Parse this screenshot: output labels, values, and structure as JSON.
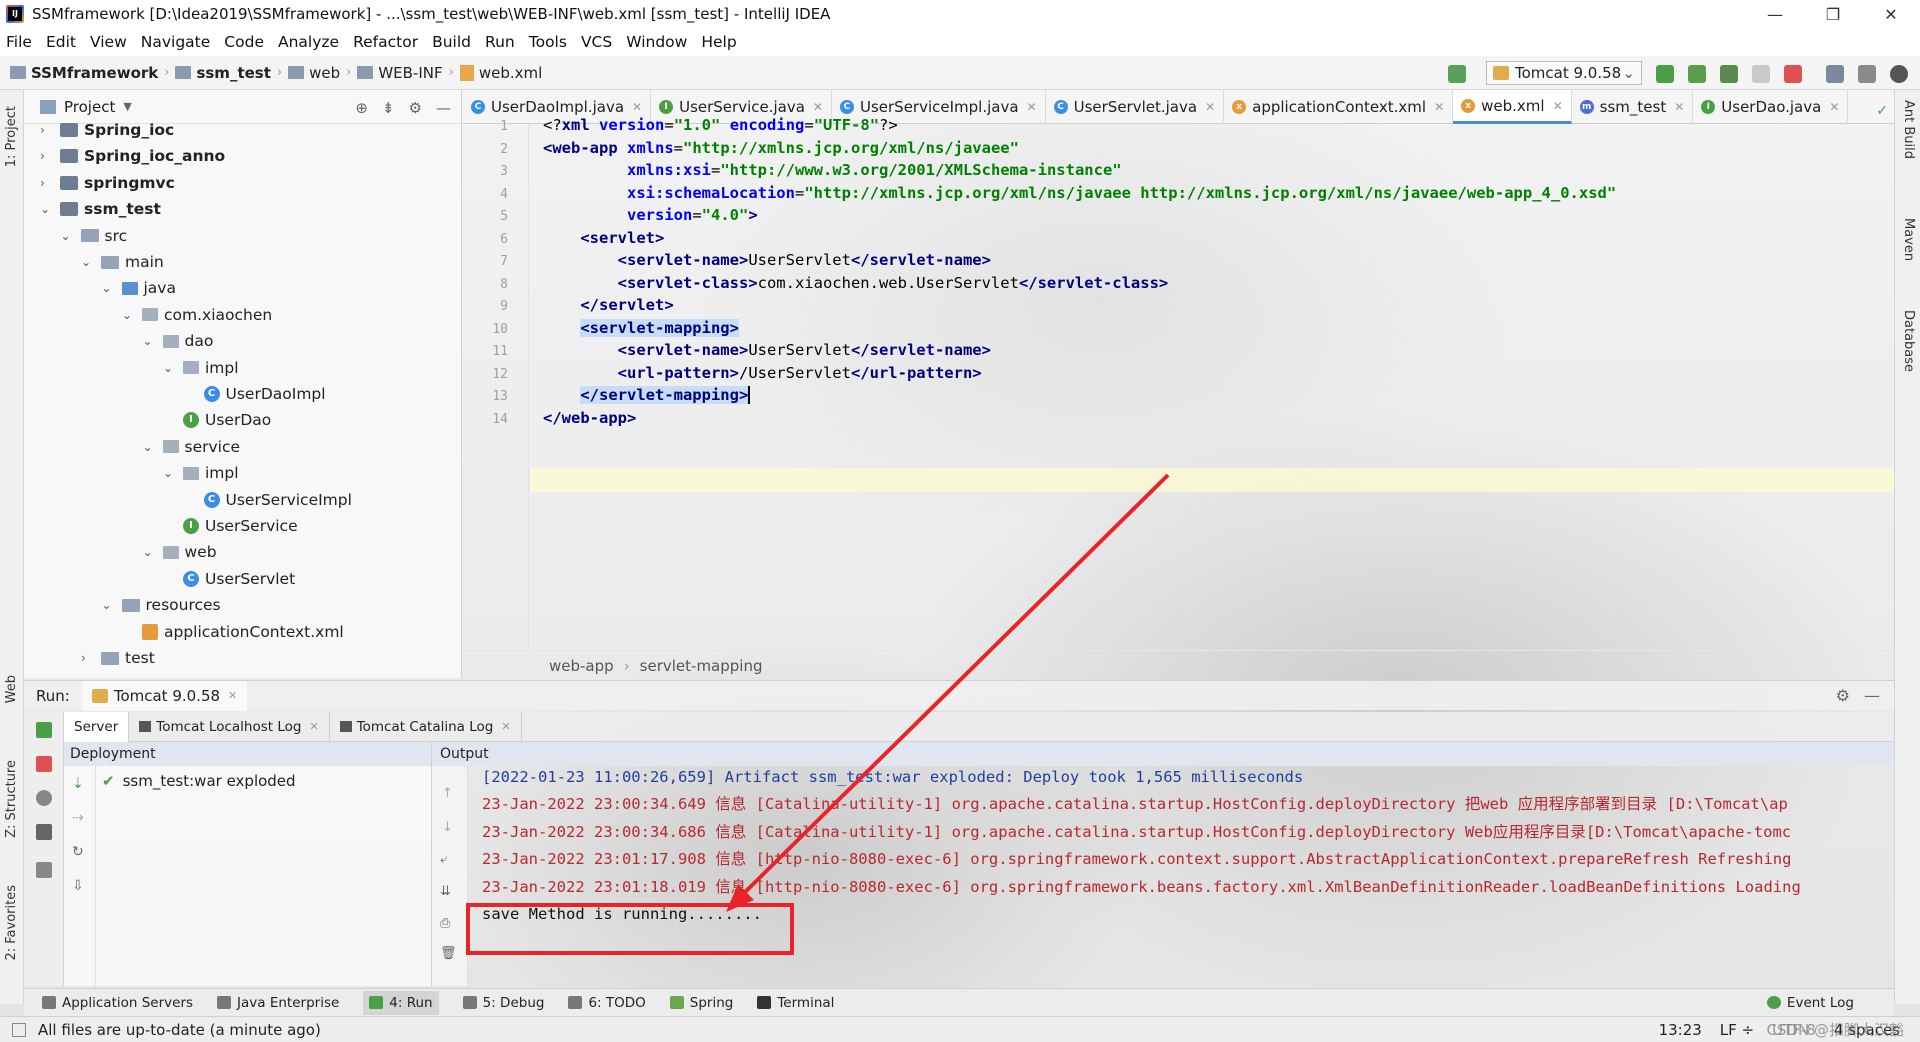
{
  "window": {
    "title": "SSMframework [D:\\Idea2019\\SSMframework] - ...\\ssm_test\\web\\WEB-INF\\web.xml [ssm_test] - IntelliJ IDEA",
    "minimize": "—",
    "maximize": "❐",
    "close": "✕"
  },
  "menu": [
    "File",
    "Edit",
    "View",
    "Navigate",
    "Code",
    "Analyze",
    "Refactor",
    "Build",
    "Run",
    "Tools",
    "VCS",
    "Window",
    "Help"
  ],
  "breadcrumbs": [
    "SSMframework",
    "ssm_test",
    "web",
    "WEB-INF",
    "web.xml"
  ],
  "run_config": "Tomcat 9.0.58",
  "project_panel": {
    "title": "Project",
    "tree": [
      {
        "label": "Spring_ioc",
        "icon": "module-icon",
        "depth": 1,
        "arrow": "›",
        "bold": true
      },
      {
        "label": "Spring_ioc_anno",
        "icon": "module-icon",
        "depth": 1,
        "arrow": "›",
        "bold": true
      },
      {
        "label": "springmvc",
        "icon": "module-icon",
        "depth": 1,
        "arrow": "›",
        "bold": true
      },
      {
        "label": "ssm_test",
        "icon": "module-icon",
        "depth": 1,
        "arrow": "⌄",
        "bold": true
      },
      {
        "label": "src",
        "icon": "folder-icon",
        "depth": 2,
        "arrow": "⌄"
      },
      {
        "label": "main",
        "icon": "folder-icon",
        "depth": 3,
        "arrow": "⌄"
      },
      {
        "label": "java",
        "icon": "java-folder-icon",
        "depth": 4,
        "arrow": "⌄"
      },
      {
        "label": "com.xiaochen",
        "icon": "package-icon",
        "depth": 5,
        "arrow": "⌄"
      },
      {
        "label": "dao",
        "icon": "package-icon",
        "depth": 6,
        "arrow": "⌄"
      },
      {
        "label": "impl",
        "icon": "package-icon",
        "depth": 7,
        "arrow": "⌄"
      },
      {
        "label": "UserDaoImpl",
        "icon": "class-icon",
        "depth": 8,
        "arrow": ""
      },
      {
        "label": "UserDao",
        "icon": "interface-icon",
        "depth": 7,
        "arrow": ""
      },
      {
        "label": "service",
        "icon": "package-icon",
        "depth": 6,
        "arrow": "⌄"
      },
      {
        "label": "impl",
        "icon": "package-icon",
        "depth": 7,
        "arrow": "⌄"
      },
      {
        "label": "UserServiceImpl",
        "icon": "class-icon",
        "depth": 8,
        "arrow": ""
      },
      {
        "label": "UserService",
        "icon": "interface-icon",
        "depth": 7,
        "arrow": ""
      },
      {
        "label": "web",
        "icon": "package-icon",
        "depth": 6,
        "arrow": "⌄"
      },
      {
        "label": "UserServlet",
        "icon": "class-icon",
        "depth": 7,
        "arrow": ""
      },
      {
        "label": "resources",
        "icon": "folder-icon",
        "depth": 4,
        "arrow": "⌄"
      },
      {
        "label": "applicationContext.xml",
        "icon": "xml-icon",
        "depth": 5,
        "arrow": ""
      },
      {
        "label": "test",
        "icon": "folder-icon",
        "depth": 3,
        "arrow": "›"
      }
    ]
  },
  "editor_tabs": [
    {
      "label": "UserDaoImpl.java",
      "icon": "C",
      "color": "#3a8ee6"
    },
    {
      "label": "UserService.java",
      "icon": "I",
      "color": "#4ba047"
    },
    {
      "label": "UserServiceImpl.java",
      "icon": "C",
      "color": "#3a8ee6"
    },
    {
      "label": "UserServlet.java",
      "icon": "C",
      "color": "#3a8ee6"
    },
    {
      "label": "applicationContext.xml",
      "icon": "x",
      "color": "#e69a3a"
    },
    {
      "label": "web.xml",
      "icon": "x",
      "color": "#e69a3a",
      "active": true
    },
    {
      "label": "ssm_test",
      "icon": "m",
      "color": "#4a6fd1"
    },
    {
      "label": "UserDao.java",
      "icon": "I",
      "color": "#4ba047"
    }
  ],
  "editor": {
    "line_numbers": [
      "1",
      "2",
      "3",
      "4",
      "5",
      "6",
      "7",
      "8",
      "9",
      "10",
      "11",
      "12",
      "13",
      "14"
    ],
    "breadcrumb": [
      "web-app",
      "servlet-mapping"
    ]
  },
  "run_panel": {
    "label": "Run:",
    "config": "Tomcat 9.0.58",
    "subtabs": [
      "Server",
      "Tomcat Localhost Log",
      "Tomcat Catalina Log"
    ],
    "deployment_header": "Deployment",
    "output_header": "Output",
    "deployment_item": "ssm_test:war exploded",
    "output_lines": [
      "[2022-01-23 11:00:26,659] Artifact ssm_test:war exploded: Deploy took 1,565 milliseconds",
      "23-Jan-2022 23:00:34.649 信息 [Catalina-utility-1] org.apache.catalina.startup.HostConfig.deployDirectory 把web 应用程序部署到目录 [D:\\Tomcat\\ap",
      "23-Jan-2022 23:00:34.686 信息 [Catalina-utility-1] org.apache.catalina.startup.HostConfig.deployDirectory Web应用程序目录[D:\\Tomcat\\apache-tomc",
      "23-Jan-2022 23:01:17.908 信息 [http-nio-8080-exec-6] org.springframework.context.support.AbstractApplicationContext.prepareRefresh Refreshing",
      "23-Jan-2022 23:01:18.019 信息 [http-nio-8080-exec-6] org.springframework.beans.factory.xml.XmlBeanDefinitionReader.loadBeanDefinitions Loading",
      "save Method is running........"
    ]
  },
  "left_tool_tabs": [
    "1: Project",
    "Web",
    "Z: Structure",
    "2: Favorites"
  ],
  "right_tool_tabs": [
    "Ant Build",
    "Maven",
    "Database"
  ],
  "bottom_tabs": [
    "Application Servers",
    "Java Enterprise",
    "4: Run",
    "5: Debug",
    "6: TODO",
    "Spring",
    "Terminal",
    "Event Log"
  ],
  "status": {
    "message": "All files are up-to-date (a minute ago)",
    "position": "13:23",
    "line_sep": "LF ÷",
    "encoding": "UTF-8",
    "indent": "4 spaces",
    "watermark": "CSDN @扣脚大汉豁"
  }
}
